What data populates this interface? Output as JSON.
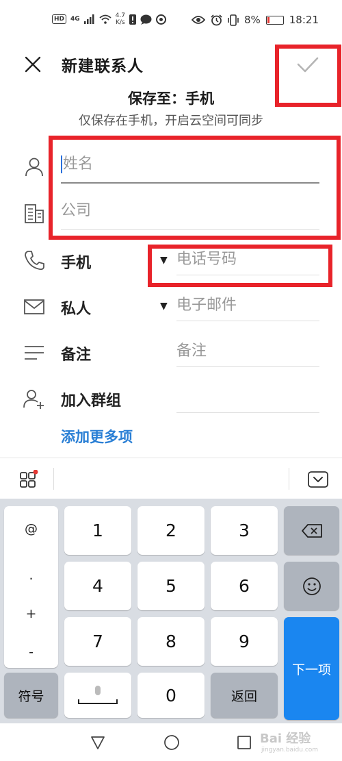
{
  "status_bar": {
    "hd": "HD",
    "network": "4G",
    "speed_value": "4.7",
    "speed_unit": "K/s",
    "battery": "8%",
    "time": "18:21"
  },
  "header": {
    "title": "新建联系人"
  },
  "save_to": "保存至：手机",
  "save_hint": "仅保存在手机，开启云空间可同步",
  "fields": {
    "name_placeholder": "姓名",
    "company_placeholder": "公司"
  },
  "rows": [
    {
      "label": "手机",
      "placeholder": "电话号码"
    },
    {
      "label": "私人",
      "placeholder": "电子邮件"
    },
    {
      "label": "备注",
      "placeholder": "备注"
    },
    {
      "label": "加入群组",
      "placeholder": ""
    }
  ],
  "add_more": "添加更多项",
  "keyboard": {
    "symbols": [
      "@",
      ".",
      "+",
      "-"
    ],
    "digits": [
      "1",
      "2",
      "3",
      "4",
      "5",
      "6",
      "7",
      "8",
      "9",
      "0"
    ],
    "symbol_key": "符号",
    "back_key": "返回",
    "next_key": "下一项"
  },
  "watermark": {
    "text": "Bai 经验",
    "sub": "jingyan.baidu.com"
  },
  "colors": {
    "accent": "#2a7fd5",
    "highlight_box": "#e8232a",
    "next_key": "#1a86f0"
  }
}
